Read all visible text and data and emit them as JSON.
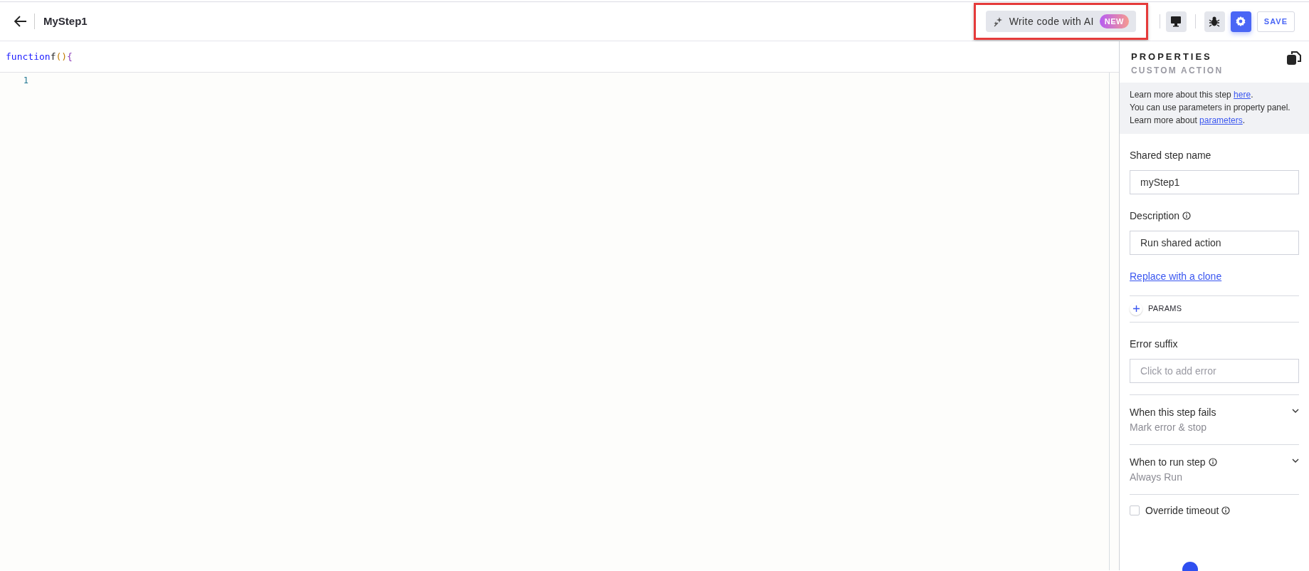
{
  "header": {
    "title": "MyStep1",
    "ai_button": {
      "label": "Write code with AI",
      "badge": "NEW",
      "highlighted": true
    },
    "toolbar": [
      {
        "kind": "monitor",
        "selected": false
      },
      {
        "kind": "bug",
        "selected": false
      },
      {
        "kind": "settings",
        "selected": true
      }
    ],
    "save_button": "SAVE"
  },
  "editor": {
    "signature": [
      {
        "kind": "keyword",
        "text": "function"
      },
      {
        "kind": "name",
        "text": "f"
      },
      {
        "kind": "paren",
        "text": "()"
      },
      {
        "kind": "brace",
        "text": "{"
      }
    ],
    "line_numbers": [
      "1"
    ]
  },
  "properties": {
    "title": "PROPERTIES",
    "subtitle": "CUSTOM ACTION",
    "info": [
      {
        "before": "Learn more about this step ",
        "link": "here",
        "after": "."
      },
      {
        "before": "You can use parameters in property panel. Learn more about ",
        "link": "parameters",
        "after": "."
      }
    ],
    "items": [
      {
        "kind": "input",
        "label": "Shared step name",
        "info": false,
        "value": "myStep1"
      },
      {
        "kind": "input",
        "label": "Description",
        "info": true,
        "value": "Run shared action"
      },
      {
        "kind": "link",
        "text": "Replace with a clone"
      },
      {
        "kind": "divider"
      },
      {
        "kind": "params",
        "text": "PARAMS"
      },
      {
        "kind": "divider"
      },
      {
        "kind": "input",
        "label": "Error suffix",
        "info": false,
        "placeholder": "Click to add error"
      },
      {
        "kind": "divider"
      },
      {
        "kind": "dropdown",
        "label": "When this step fails",
        "info": false,
        "value": "Mark error & stop",
        "expanded": false
      },
      {
        "kind": "divider"
      },
      {
        "kind": "dropdown",
        "label": "When to run step",
        "info": true,
        "value": "Always Run",
        "expanded": false
      },
      {
        "kind": "divider"
      },
      {
        "kind": "checkbox",
        "label": "Override timeout",
        "info": true,
        "checked": false
      }
    ]
  }
}
